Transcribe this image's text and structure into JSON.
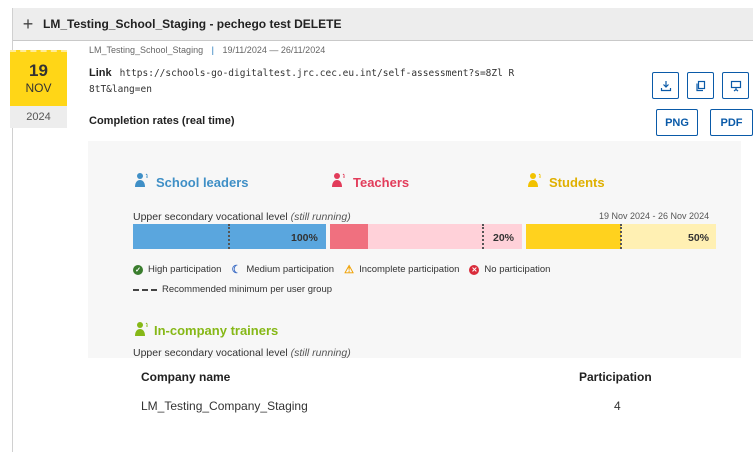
{
  "header": {
    "expand_symbol": "+",
    "title": "LM_Testing_School_Staging - pechego test DELETE"
  },
  "date": {
    "day": "19",
    "month": "NOV",
    "year": "2024"
  },
  "meta": {
    "school": "LM_Testing_School_Staging",
    "separator": "|",
    "period": "19/11/2024 — 26/11/2024"
  },
  "link": {
    "label": "Link",
    "url": "https://schools-go-digitaltest.jrc.cec.eu.int/self-assessment?s=8Zl R8tT&lang=en"
  },
  "actions": {
    "png_label": "PNG",
    "pdf_label": "PDF"
  },
  "completion_label": "Completion rates (real time)",
  "groups": {
    "leaders": {
      "label": "School leaders",
      "color": "#3f8fc6"
    },
    "teachers": {
      "label": "Teachers",
      "color": "#e23c5a"
    },
    "students": {
      "label": "Students",
      "color": "#f2c200"
    }
  },
  "level": {
    "text": "Upper secondary vocational level",
    "status": "(still running)"
  },
  "date_range": "19 Nov 2024 - 26 Nov 2024",
  "bars": {
    "leaders_value": "100%",
    "teachers_value": "20%",
    "students_value": "50%"
  },
  "participation": {
    "leaders": 1.0,
    "teachers": 0.2,
    "students": 0.5
  },
  "legend": {
    "high": "High participation",
    "medium": "Medium participation",
    "incomplete": "Incomplete participation",
    "none": "No participation",
    "recommended": "Recommended minimum per user group"
  },
  "trainers": {
    "title": "In-company trainers",
    "level_text": "Upper secondary vocational level",
    "level_status": "(still running)",
    "columns": [
      "Company name",
      "Participation"
    ],
    "rows": [
      {
        "company": "LM_Testing_Company_Staging",
        "participation": "4"
      }
    ]
  }
}
